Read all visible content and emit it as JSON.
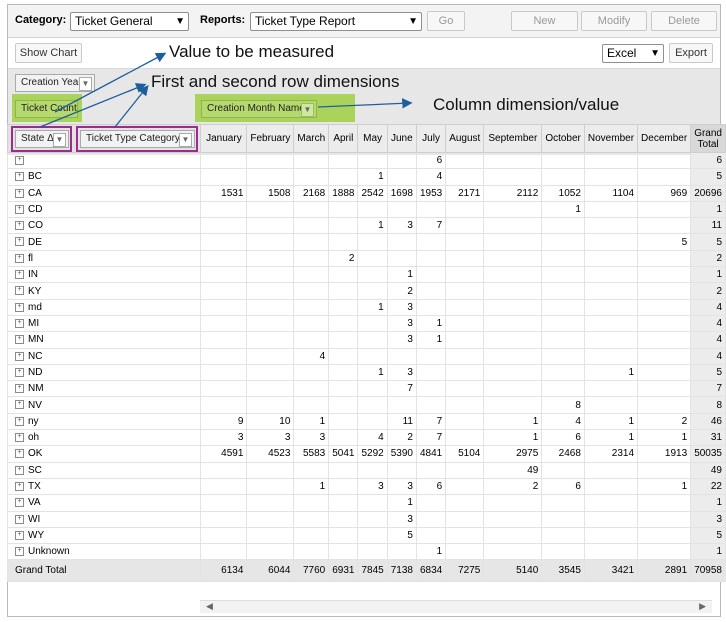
{
  "toolbar": {
    "category_label": "Category:",
    "category_value": "Ticket General",
    "reports_label": "Reports:",
    "reports_value": "Ticket Type Report",
    "go_label": "Go",
    "new_label": "New",
    "modify_label": "Modify",
    "delete_label": "Delete"
  },
  "toolbar2": {
    "show_chart_label": "Show Chart",
    "export_format": "Excel",
    "export_label": "Export"
  },
  "filter_area": {
    "filter_chip": "Creation Year",
    "data_chip": "Ticket Count",
    "column_chip": "Creation Month Name",
    "row_chip_1": "State Δ",
    "row_chip_2": "Ticket Type Category Δ"
  },
  "annotations": {
    "value": "Value to be measured",
    "rows": "First and second row dimensions",
    "column": "Column dimension/value"
  },
  "colors": {
    "highlight": "#a9d35a",
    "row_outline": "#9a2c8e",
    "arrow": "#1f5e9c"
  },
  "pivot": {
    "columns": [
      "January",
      "February",
      "March",
      "April",
      "May",
      "June",
      "July",
      "August",
      "September",
      "October",
      "November",
      "December",
      "Grand Total"
    ],
    "rows": [
      {
        "state": "",
        "values": [
          "",
          "",
          "",
          "",
          "",
          "",
          "6",
          "",
          "",
          "",
          "",
          "",
          "6"
        ]
      },
      {
        "state": "BC",
        "values": [
          "",
          "",
          "",
          "",
          "1",
          "",
          "4",
          "",
          "",
          "",
          "",
          "",
          "5"
        ]
      },
      {
        "state": "CA",
        "values": [
          "1531",
          "1508",
          "2168",
          "1888",
          "2542",
          "1698",
          "1953",
          "2171",
          "2112",
          "1052",
          "1104",
          "969",
          "20696"
        ]
      },
      {
        "state": "CD",
        "values": [
          "",
          "",
          "",
          "",
          "",
          "",
          "",
          "",
          "",
          "1",
          "",
          "",
          "1"
        ]
      },
      {
        "state": "CO",
        "values": [
          "",
          "",
          "",
          "",
          "1",
          "3",
          "7",
          "",
          "",
          "",
          "",
          "",
          "11"
        ]
      },
      {
        "state": "DE",
        "values": [
          "",
          "",
          "",
          "",
          "",
          "",
          "",
          "",
          "",
          "",
          "",
          "5",
          "5"
        ]
      },
      {
        "state": "fl",
        "values": [
          "",
          "",
          "",
          "2",
          "",
          "",
          "",
          "",
          "",
          "",
          "",
          "",
          "2"
        ]
      },
      {
        "state": "IN",
        "values": [
          "",
          "",
          "",
          "",
          "",
          "1",
          "",
          "",
          "",
          "",
          "",
          "",
          "1"
        ]
      },
      {
        "state": "KY",
        "values": [
          "",
          "",
          "",
          "",
          "",
          "2",
          "",
          "",
          "",
          "",
          "",
          "",
          "2"
        ]
      },
      {
        "state": "md",
        "values": [
          "",
          "",
          "",
          "",
          "1",
          "3",
          "",
          "",
          "",
          "",
          "",
          "",
          "4"
        ]
      },
      {
        "state": "MI",
        "values": [
          "",
          "",
          "",
          "",
          "",
          "3",
          "1",
          "",
          "",
          "",
          "",
          "",
          "4"
        ]
      },
      {
        "state": "MN",
        "values": [
          "",
          "",
          "",
          "",
          "",
          "3",
          "1",
          "",
          "",
          "",
          "",
          "",
          "4"
        ]
      },
      {
        "state": "NC",
        "values": [
          "",
          "",
          "4",
          "",
          "",
          "",
          "",
          "",
          "",
          "",
          "",
          "",
          "4"
        ]
      },
      {
        "state": "ND",
        "values": [
          "",
          "",
          "",
          "",
          "1",
          "3",
          "",
          "",
          "",
          "",
          "1",
          "",
          "5"
        ]
      },
      {
        "state": "NM",
        "values": [
          "",
          "",
          "",
          "",
          "",
          "7",
          "",
          "",
          "",
          "",
          "",
          "",
          "7"
        ]
      },
      {
        "state": "NV",
        "values": [
          "",
          "",
          "",
          "",
          "",
          "",
          "",
          "",
          "",
          "8",
          "",
          "",
          "8"
        ]
      },
      {
        "state": "ny",
        "values": [
          "9",
          "10",
          "1",
          "",
          "",
          "11",
          "7",
          "",
          "1",
          "4",
          "1",
          "2",
          "46"
        ]
      },
      {
        "state": "oh",
        "values": [
          "3",
          "3",
          "3",
          "",
          "4",
          "2",
          "7",
          "",
          "1",
          "6",
          "1",
          "1",
          "31"
        ]
      },
      {
        "state": "OK",
        "values": [
          "4591",
          "4523",
          "5583",
          "5041",
          "5292",
          "5390",
          "4841",
          "5104",
          "2975",
          "2468",
          "2314",
          "1913",
          "50035"
        ]
      },
      {
        "state": "SC",
        "values": [
          "",
          "",
          "",
          "",
          "",
          "",
          "",
          "",
          "49",
          "",
          "",
          "",
          "49"
        ]
      },
      {
        "state": "TX",
        "values": [
          "",
          "",
          "1",
          "",
          "3",
          "3",
          "6",
          "",
          "2",
          "6",
          "",
          "1",
          "22"
        ]
      },
      {
        "state": "VA",
        "values": [
          "",
          "",
          "",
          "",
          "",
          "1",
          "",
          "",
          "",
          "",
          "",
          "",
          "1"
        ]
      },
      {
        "state": "WI",
        "values": [
          "",
          "",
          "",
          "",
          "",
          "3",
          "",
          "",
          "",
          "",
          "",
          "",
          "3"
        ]
      },
      {
        "state": "WY",
        "values": [
          "",
          "",
          "",
          "",
          "",
          "5",
          "",
          "",
          "",
          "",
          "",
          "",
          "5"
        ]
      },
      {
        "state": "Unknown",
        "values": [
          "",
          "",
          "",
          "",
          "",
          "",
          "1",
          "",
          "",
          "",
          "",
          "",
          "1"
        ]
      }
    ],
    "grand_total_label": "Grand Total",
    "grand_totals": [
      "6134",
      "6044",
      "7760",
      "6931",
      "7845",
      "7138",
      "6834",
      "7275",
      "5140",
      "3545",
      "3421",
      "2891",
      "70958"
    ]
  }
}
